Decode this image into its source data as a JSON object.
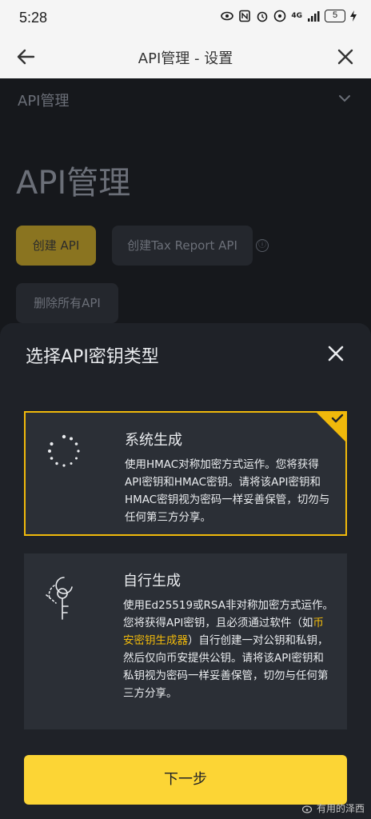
{
  "status": {
    "time": "5:28",
    "battery": "5",
    "network": "4G"
  },
  "appbar": {
    "title": "API管理 - 设置"
  },
  "background": {
    "section_title": "API管理",
    "page_title": "API管理",
    "create_api": "创建 API",
    "create_tax_api": "创建Tax Report API",
    "info_icon": "ⓘ",
    "delete_all": "删除所有API"
  },
  "sheet": {
    "title": "选择API密钥类型",
    "options": [
      {
        "title": "系统生成",
        "desc": "使用HMAC对称加密方式运作。您将获得API密钥和HMAC密钥。请将该API密钥和HMAC密钥视为密码一样妥善保管，切勿与任何第三方分享。",
        "selected": true
      },
      {
        "title": "自行生成",
        "desc_part1": "使用Ed25519或RSA非对称加密方式运作。您将获得API密钥，且必须通过软件（如",
        "desc_link": "币安密钥生成器",
        "desc_part2": "）自行创建一对公钥和私钥，然后仅向币安提供公钥。请将该API密钥和私钥视为密码一样妥善保管，切勿与任何第三方分享。",
        "selected": false
      }
    ],
    "next_button": "下一步"
  },
  "watermark": "有用的泽西",
  "colors": {
    "accent": "#f0b90b",
    "button": "#fcd535",
    "sheet_bg": "#1f2228",
    "card_bg": "#2b2f36"
  }
}
